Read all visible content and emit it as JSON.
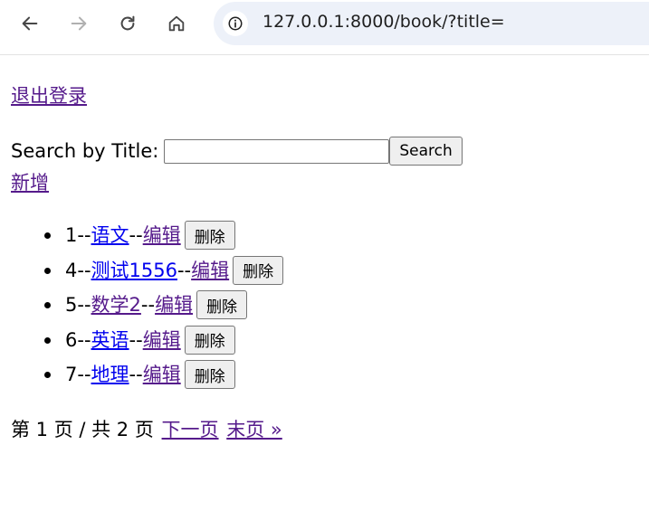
{
  "browser": {
    "url": "127.0.0.1:8000/book/?title=",
    "icons": [
      "back-icon",
      "forward-icon",
      "reload-icon",
      "home-icon",
      "info-icon"
    ]
  },
  "page": {
    "logout_label": "退出登录",
    "search": {
      "label": "Search by Title:",
      "value": "",
      "button_label": "Search"
    },
    "add_label": "新增",
    "books": [
      {
        "id": "1",
        "title": "语文",
        "edit_label": "编辑",
        "delete_label": "删除"
      },
      {
        "id": "4",
        "title": "测试1556",
        "edit_label": "编辑",
        "delete_label": "删除"
      },
      {
        "id": "5",
        "title": "数学2",
        "edit_label": "编辑",
        "delete_label": "删除"
      },
      {
        "id": "6",
        "title": "英语",
        "edit_label": "编辑",
        "delete_label": "删除"
      },
      {
        "id": "7",
        "title": "地理",
        "edit_label": "编辑",
        "delete_label": "删除"
      }
    ],
    "separator": "--",
    "pagination": {
      "status": "第 1 页 / 共 2 页",
      "next_label": "下一页",
      "last_label": "末页 »"
    }
  },
  "colors": {
    "link": "#0000ee",
    "visited_link": "#551a8b",
    "omnibox_bg": "#edf1f9"
  }
}
